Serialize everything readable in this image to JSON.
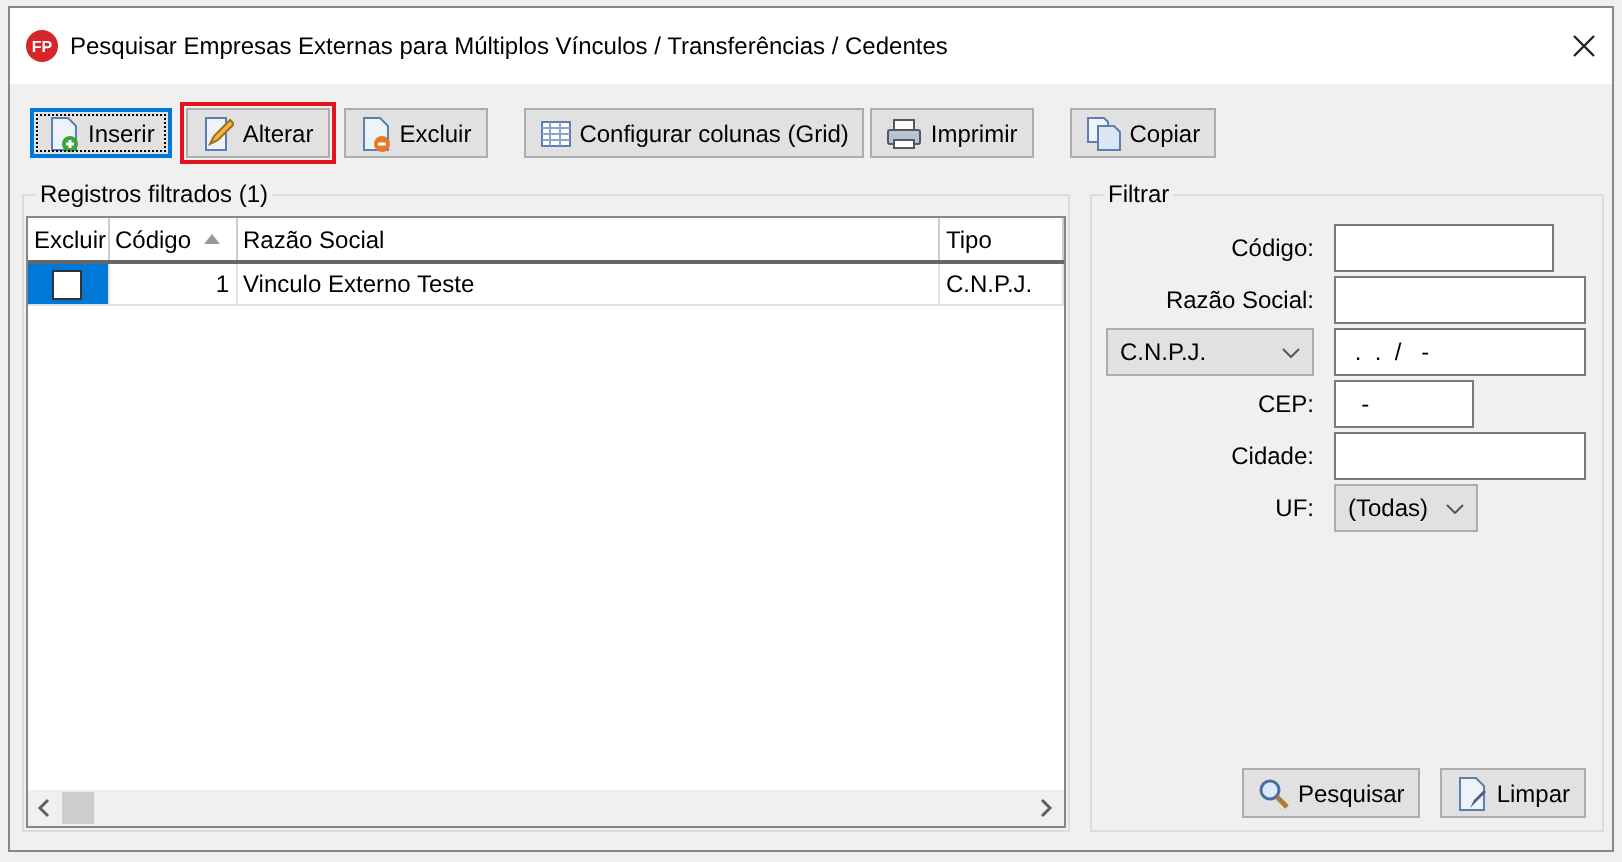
{
  "window": {
    "logo": "FP",
    "title": "Pesquisar Empresas Externas para Múltiplos Vínculos / Transferências / Cedentes"
  },
  "toolbar": [
    [
      {
        "label": "Inserir",
        "kind": "insert",
        "focused": true,
        "highlighted": false
      },
      {
        "label": "Alterar",
        "kind": "edit",
        "focused": false,
        "highlighted": true
      },
      {
        "label": "Excluir",
        "kind": "delete",
        "focused": false,
        "highlighted": false
      }
    ],
    [
      {
        "label": "Configurar colunas (Grid)",
        "kind": "columns",
        "focused": false,
        "highlighted": false
      },
      {
        "label": "Imprimir",
        "kind": "print",
        "focused": false,
        "highlighted": false
      }
    ],
    [
      {
        "label": "Copiar",
        "kind": "copy",
        "focused": false,
        "highlighted": false
      }
    ]
  ],
  "results": {
    "title": "Registros filtrados (1)",
    "table": {
      "columns": [
        {
          "label": "Excluir",
          "sorted": false
        },
        {
          "label": "Código",
          "sorted": true
        },
        {
          "label": "Razão Social",
          "sorted": false
        },
        {
          "label": "Tipo",
          "sorted": false
        }
      ],
      "rows": [
        {
          "checked": false,
          "selected": true,
          "cells": [
            "",
            "1",
            "Vinculo Externo Teste",
            "C.N.P.J."
          ]
        }
      ]
    }
  },
  "filter": {
    "title": "Filtrar",
    "fields": [
      {
        "kind": "text",
        "label": "Código:"
      },
      {
        "kind": "text",
        "label": "Razão Social:"
      },
      {
        "kind": "select-text",
        "selector": "C.N.P.J.",
        "value": " .  .  /   -"
      },
      {
        "kind": "text",
        "label": "CEP:",
        "value": "  -"
      },
      {
        "kind": "text",
        "label": "Cidade:"
      },
      {
        "kind": "select",
        "label": "UF:",
        "value": "(Todas)"
      }
    ],
    "buttons": [
      {
        "label": "Pesquisar",
        "kind": "search"
      },
      {
        "label": "Limpar",
        "kind": "clear"
      }
    ]
  }
}
